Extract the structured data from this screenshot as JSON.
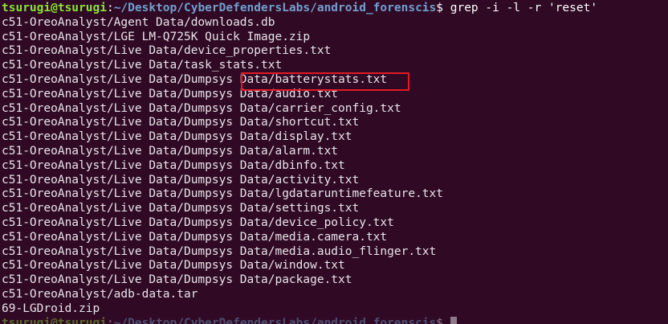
{
  "prompt": {
    "user_host": "tsurugi@tsurugi",
    "separator": ":",
    "path": "~/Desktop/CyberDefendersLabs/android_forenscis",
    "symbol": "$",
    "command": " grep -i -l -r 'reset'"
  },
  "output_lines": [
    "c51-OreoAnalyst/Agent Data/downloads.db",
    "c51-OreoAnalyst/LGE LM-Q725K Quick Image.zip",
    "c51-OreoAnalyst/Live Data/device_properties.txt",
    "c51-OreoAnalyst/Live Data/task_stats.txt",
    "c51-OreoAnalyst/Live Data/Dumpsys Data/batterystats.txt",
    "c51-OreoAnalyst/Live Data/Dumpsys Data/audio.txt",
    "c51-OreoAnalyst/Live Data/Dumpsys Data/carrier_config.txt",
    "c51-OreoAnalyst/Live Data/Dumpsys Data/shortcut.txt",
    "c51-OreoAnalyst/Live Data/Dumpsys Data/display.txt",
    "c51-OreoAnalyst/Live Data/Dumpsys Data/alarm.txt",
    "c51-OreoAnalyst/Live Data/Dumpsys Data/dbinfo.txt",
    "c51-OreoAnalyst/Live Data/Dumpsys Data/activity.txt",
    "c51-OreoAnalyst/Live Data/Dumpsys Data/lgdataruntimefeature.txt",
    "c51-OreoAnalyst/Live Data/Dumpsys Data/settings.txt",
    "c51-OreoAnalyst/Live Data/Dumpsys Data/device_policy.txt",
    "c51-OreoAnalyst/Live Data/Dumpsys Data/media.camera.txt",
    "c51-OreoAnalyst/Live Data/Dumpsys Data/media.audio_flinger.txt",
    "c51-OreoAnalyst/Live Data/Dumpsys Data/window.txt",
    "c51-OreoAnalyst/Live Data/Dumpsys Data/package.txt",
    "c51-OreoAnalyst/adb-data.tar",
    "69-LGDroid.zip"
  ],
  "highlighted_line_index": 4,
  "highlight_color": "#e01b24",
  "colors": {
    "background": "#300a24",
    "user": "#8ae234",
    "path": "#729fcf",
    "text": "#ffffff"
  }
}
